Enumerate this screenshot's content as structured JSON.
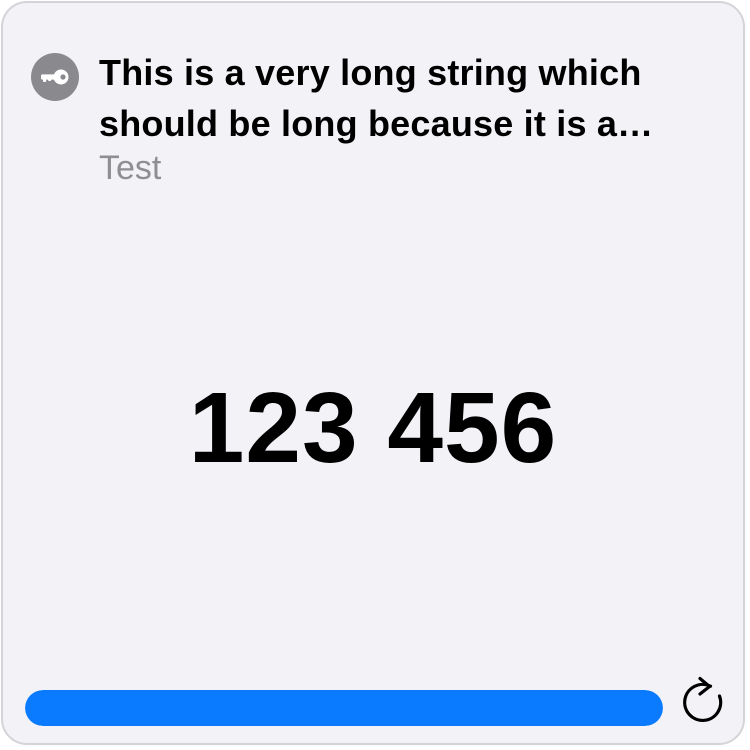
{
  "account": {
    "icon": "key-icon",
    "title": "This is a very long string which should be long because it is a test",
    "subtitle": "Test"
  },
  "code": {
    "value": "123 456"
  },
  "progress": {
    "fraction": 1.0,
    "color": "#0a7aff"
  },
  "actions": {
    "refresh_icon": "refresh-icon"
  }
}
